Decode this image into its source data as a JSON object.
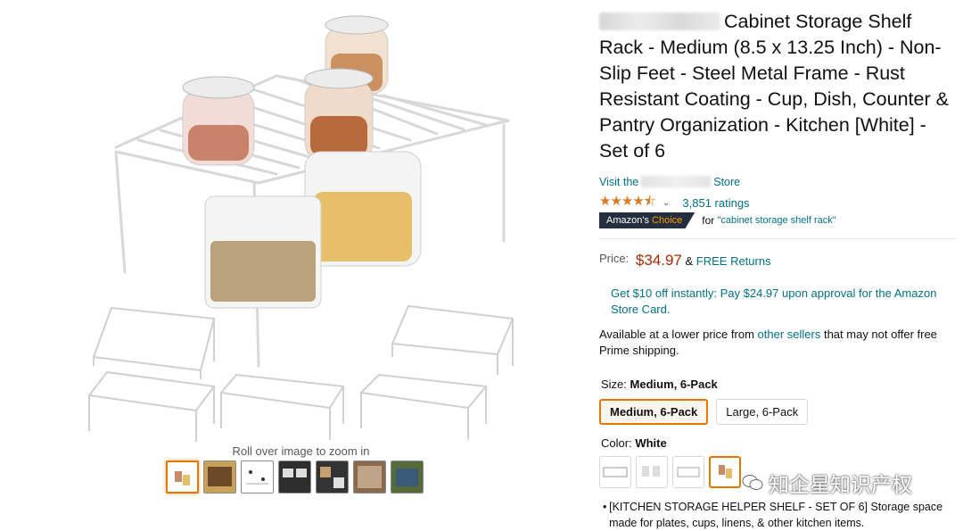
{
  "product": {
    "title": "Cabinet Storage Shelf Rack - Medium (8.5 x 13.25 Inch) - Non-Slip Feet - Steel Metal Frame - Rust Resistant Coating - Cup, Dish, Counter & Pantry Organization - Kitchen [White] - Set of 6",
    "store_prefix": "Visit the",
    "store_suffix": "Store",
    "star_rating": 4.5,
    "ratings_count": "3,851 ratings",
    "badge_prefix": "Amazon's",
    "badge_choice": "Choice",
    "choice_for": "for",
    "choice_keyword": "\"cabinet storage shelf rack\""
  },
  "price": {
    "label": "Price:",
    "value": "$34.97",
    "amp": "&",
    "free_returns": "FREE Returns"
  },
  "offer_text": "Get $10 off instantly: Pay $24.97 upon approval for the Amazon Store Card.",
  "availability": {
    "pre": "Available at a lower price from",
    "link": "other sellers",
    "post": "that may not offer free Prime shipping."
  },
  "size": {
    "label": "Size:",
    "selected": "Medium, 6-Pack",
    "options": [
      "Medium, 6-Pack",
      "Large, 6-Pack"
    ]
  },
  "color": {
    "label": "Color:",
    "selected": "White"
  },
  "gallery": {
    "zoom_hint": "Roll over image to zoom in",
    "thumbnail_count": 7
  },
  "bullet_1": "[KITCHEN STORAGE HELPER SHELF - SET OF 6] Storage space made for plates, cups, linens, & other kitchen items.",
  "watermark": "知企星知识产权",
  "colors": {
    "link": "#007185",
    "price": "#B12704",
    "star": "#de7921",
    "selected_border": "#e77600",
    "badge_bg": "#232F3E"
  }
}
